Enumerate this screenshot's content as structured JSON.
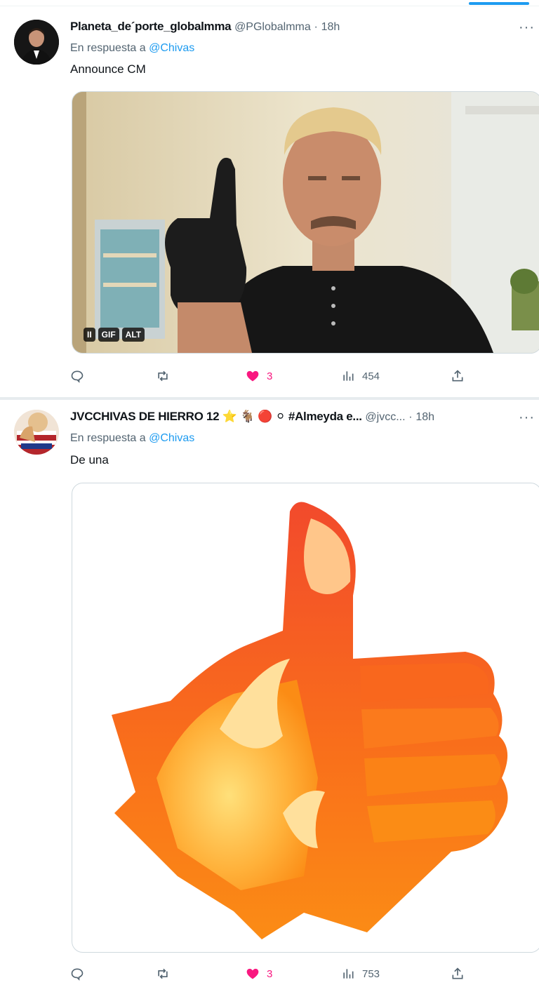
{
  "colors": {
    "accent": "#1d9bf0",
    "like": "#f91880",
    "muted": "#536471",
    "text": "#0f1419"
  },
  "tweets": [
    {
      "display_name": "Planeta_de´porte_globalmma",
      "handle": "@PGlobalmma",
      "separator": "·",
      "time": "18h",
      "reply_prefix": "En respuesta a",
      "reply_to": "@Chivas",
      "text": "Announce CM",
      "media": {
        "type": "gif",
        "badges": [
          "GIF",
          "ALT"
        ],
        "pause_icon": "pause-icon"
      },
      "actions": {
        "reply_count": "",
        "retweet_count": "",
        "like_count": "3",
        "liked": true,
        "views": "454"
      }
    },
    {
      "display_name": "JVCCHIVAS DE HIERRO 12 ⭐ 🐐 🔴 ⚪ #Almeyda e...",
      "handle": "@jvcc...",
      "separator": "·",
      "time": "18h",
      "reply_prefix": "En respuesta a",
      "reply_to": "@Chivas",
      "text": "De una",
      "media": {
        "type": "image",
        "icon": "fire-thumbs-up-icon"
      },
      "actions": {
        "reply_count": "",
        "retweet_count": "",
        "like_count": "3",
        "liked": true,
        "views": "753"
      }
    }
  ]
}
